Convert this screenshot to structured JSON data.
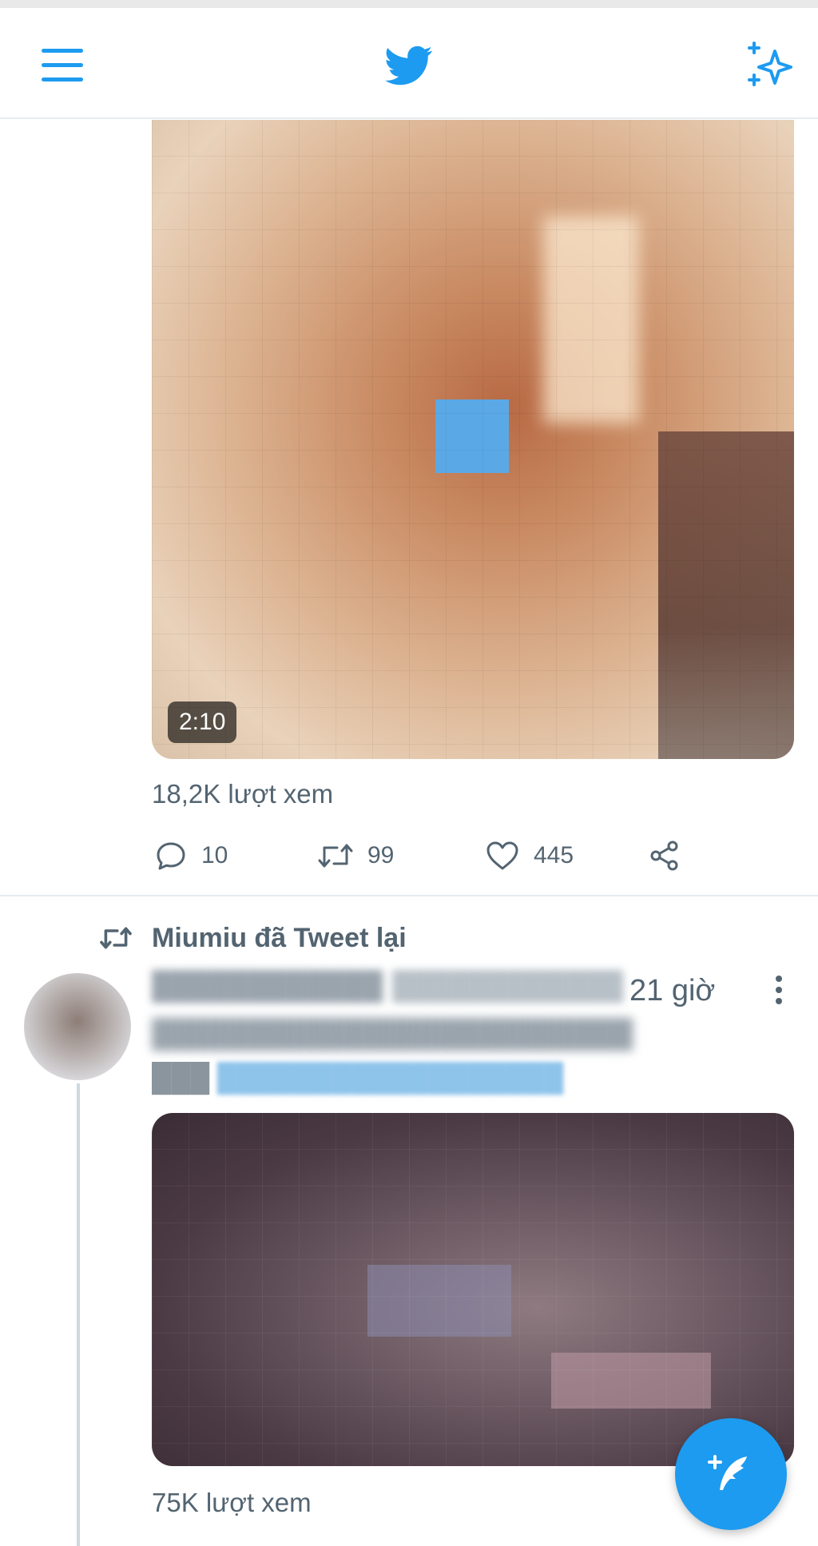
{
  "header": {
    "menu_icon": "hamburger-menu-icon",
    "logo_icon": "twitter-bird-icon",
    "sparkle_icon": "sparkle-icon"
  },
  "tweet1": {
    "video_duration": "2:10",
    "views": "18,2K lượt xem",
    "actions": {
      "reply_count": "10",
      "retweet_count": "99",
      "like_count": "445"
    }
  },
  "tweet2": {
    "retweeted_by": "Miumiu đã Tweet lại",
    "time": "21 giờ",
    "views": "75K lượt xem"
  },
  "colors": {
    "accent": "#1d9bf0",
    "text_secondary": "#536471",
    "divider": "#e6ecf0"
  }
}
